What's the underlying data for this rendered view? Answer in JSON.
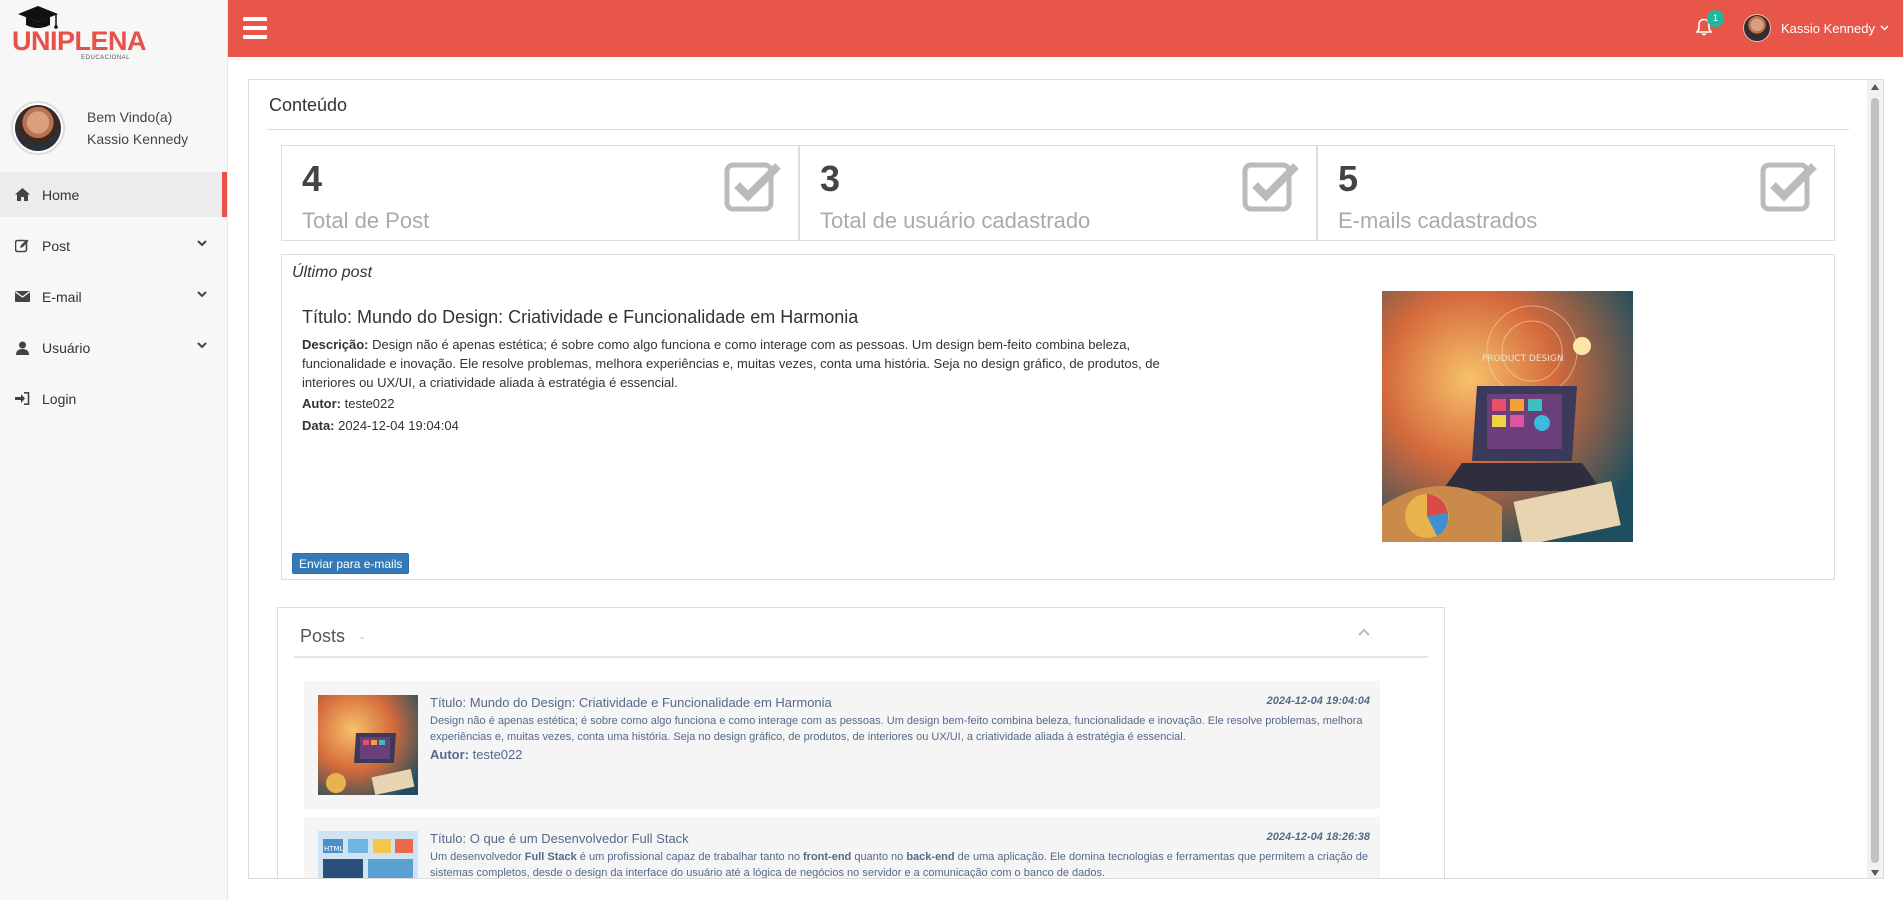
{
  "brand": {
    "name": "UNIPLENA",
    "sub": "EDUCACIONAL"
  },
  "profile": {
    "greeting": "Bem Vindo(a)",
    "name": "Kassio Kennedy"
  },
  "sidebar": {
    "items": [
      {
        "label": "Home",
        "icon": "home-icon"
      },
      {
        "label": "Post",
        "icon": "edit-icon"
      },
      {
        "label": "E-mail",
        "icon": "envelope-icon"
      },
      {
        "label": "Usuário",
        "icon": "user-icon"
      },
      {
        "label": "Login",
        "icon": "sign-in-icon"
      }
    ]
  },
  "topbar": {
    "notification_count": "1",
    "user_name": "Kassio Kennedy"
  },
  "content": {
    "title": "Conteúdo"
  },
  "stats": [
    {
      "value": "4",
      "label": "Total de Post"
    },
    {
      "value": "3",
      "label": "Total de usuário cadastrado"
    },
    {
      "value": "5",
      "label": "E-mails cadastrados"
    }
  ],
  "last_post": {
    "heading": "Último post",
    "title": "Título: Mundo do Design: Criatividade e Funcionalidade em Harmonia",
    "description_label": "Descrição:",
    "description": "Design não é apenas estética; é sobre como algo funciona e como interage com as pessoas. Um design bem-feito combina beleza, funcionalidade e inovação. Ele resolve problemas, melhora experiências e, muitas vezes, conta uma história. Seja no design gráfico, de produtos, de interiores ou UX/UI, a criatividade aliada à estratégia é essencial.",
    "author_label": "Autor:",
    "author": "teste022",
    "date_label": "Data:",
    "date": "2024-12-04 19:04:04",
    "image_text": "PRODUCT DESIGN",
    "send_button": "Enviar para e-mails"
  },
  "posts_panel": {
    "title": "Posts",
    "dash": "-",
    "items": [
      {
        "title": "Título: Mundo do Design: Criatividade e Funcionalidade em Harmonia",
        "date": "2024-12-04 19:04:04",
        "description": "Design não é apenas estética; é sobre como algo funciona e como interage com as pessoas. Um design bem-feito combina beleza, funcionalidade e inovação. Ele resolve problemas, melhora experiências e, muitas vezes, conta uma história. Seja no design gráfico, de produtos, de interiores ou UX/UI, a criatividade aliada à estratégia é essencial.",
        "author_label": "Autor:",
        "author": "teste022"
      },
      {
        "title": "Título: O que é um Desenvolvedor Full Stack",
        "date": "2024-12-04 18:26:38",
        "desc_a": "Um desenvolvedor ",
        "desc_b": "Full Stack",
        "desc_c": " é um profissional capaz de trabalhar tanto no ",
        "desc_d": "front-end",
        "desc_e": " quanto no ",
        "desc_f": "back-end",
        "desc_g": " de uma aplicação. Ele domina tecnologias e ferramentas que permitem a criação de sistemas completos, desde o design da interface do usuário até a lógica de negócios no servidor e a comunicação com o banco de dados."
      }
    ]
  },
  "colors": {
    "accent": "#e8564a",
    "badge": "#1fb79e",
    "button": "#337ab7",
    "post_text": "#56698a"
  }
}
